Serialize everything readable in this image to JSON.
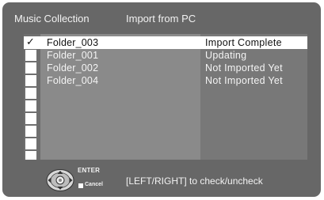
{
  "header": {
    "title": "Music Collection",
    "mode": "Import from PC"
  },
  "rows": [
    {
      "checked": true,
      "check_mark": "✓",
      "name": "Folder_003",
      "status": "Import Complete",
      "selected": true
    },
    {
      "checked": false,
      "check_mark": "",
      "name": "Folder_001",
      "status": "Updating",
      "selected": false
    },
    {
      "checked": false,
      "check_mark": "",
      "name": "Folder_002",
      "status": "Not Imported Yet",
      "selected": false
    },
    {
      "checked": false,
      "check_mark": "",
      "name": "Folder_004",
      "status": "Not Imported Yet",
      "selected": false
    }
  ],
  "empty_rows": 6,
  "footer": {
    "enter_label": "ENTER",
    "cancel_label": "Cancel",
    "hint": "[LEFT/RIGHT] to check/uncheck"
  },
  "colors": {
    "background": "#676767",
    "list_bg": "#8a8a8a",
    "highlight": "#ffffff"
  }
}
